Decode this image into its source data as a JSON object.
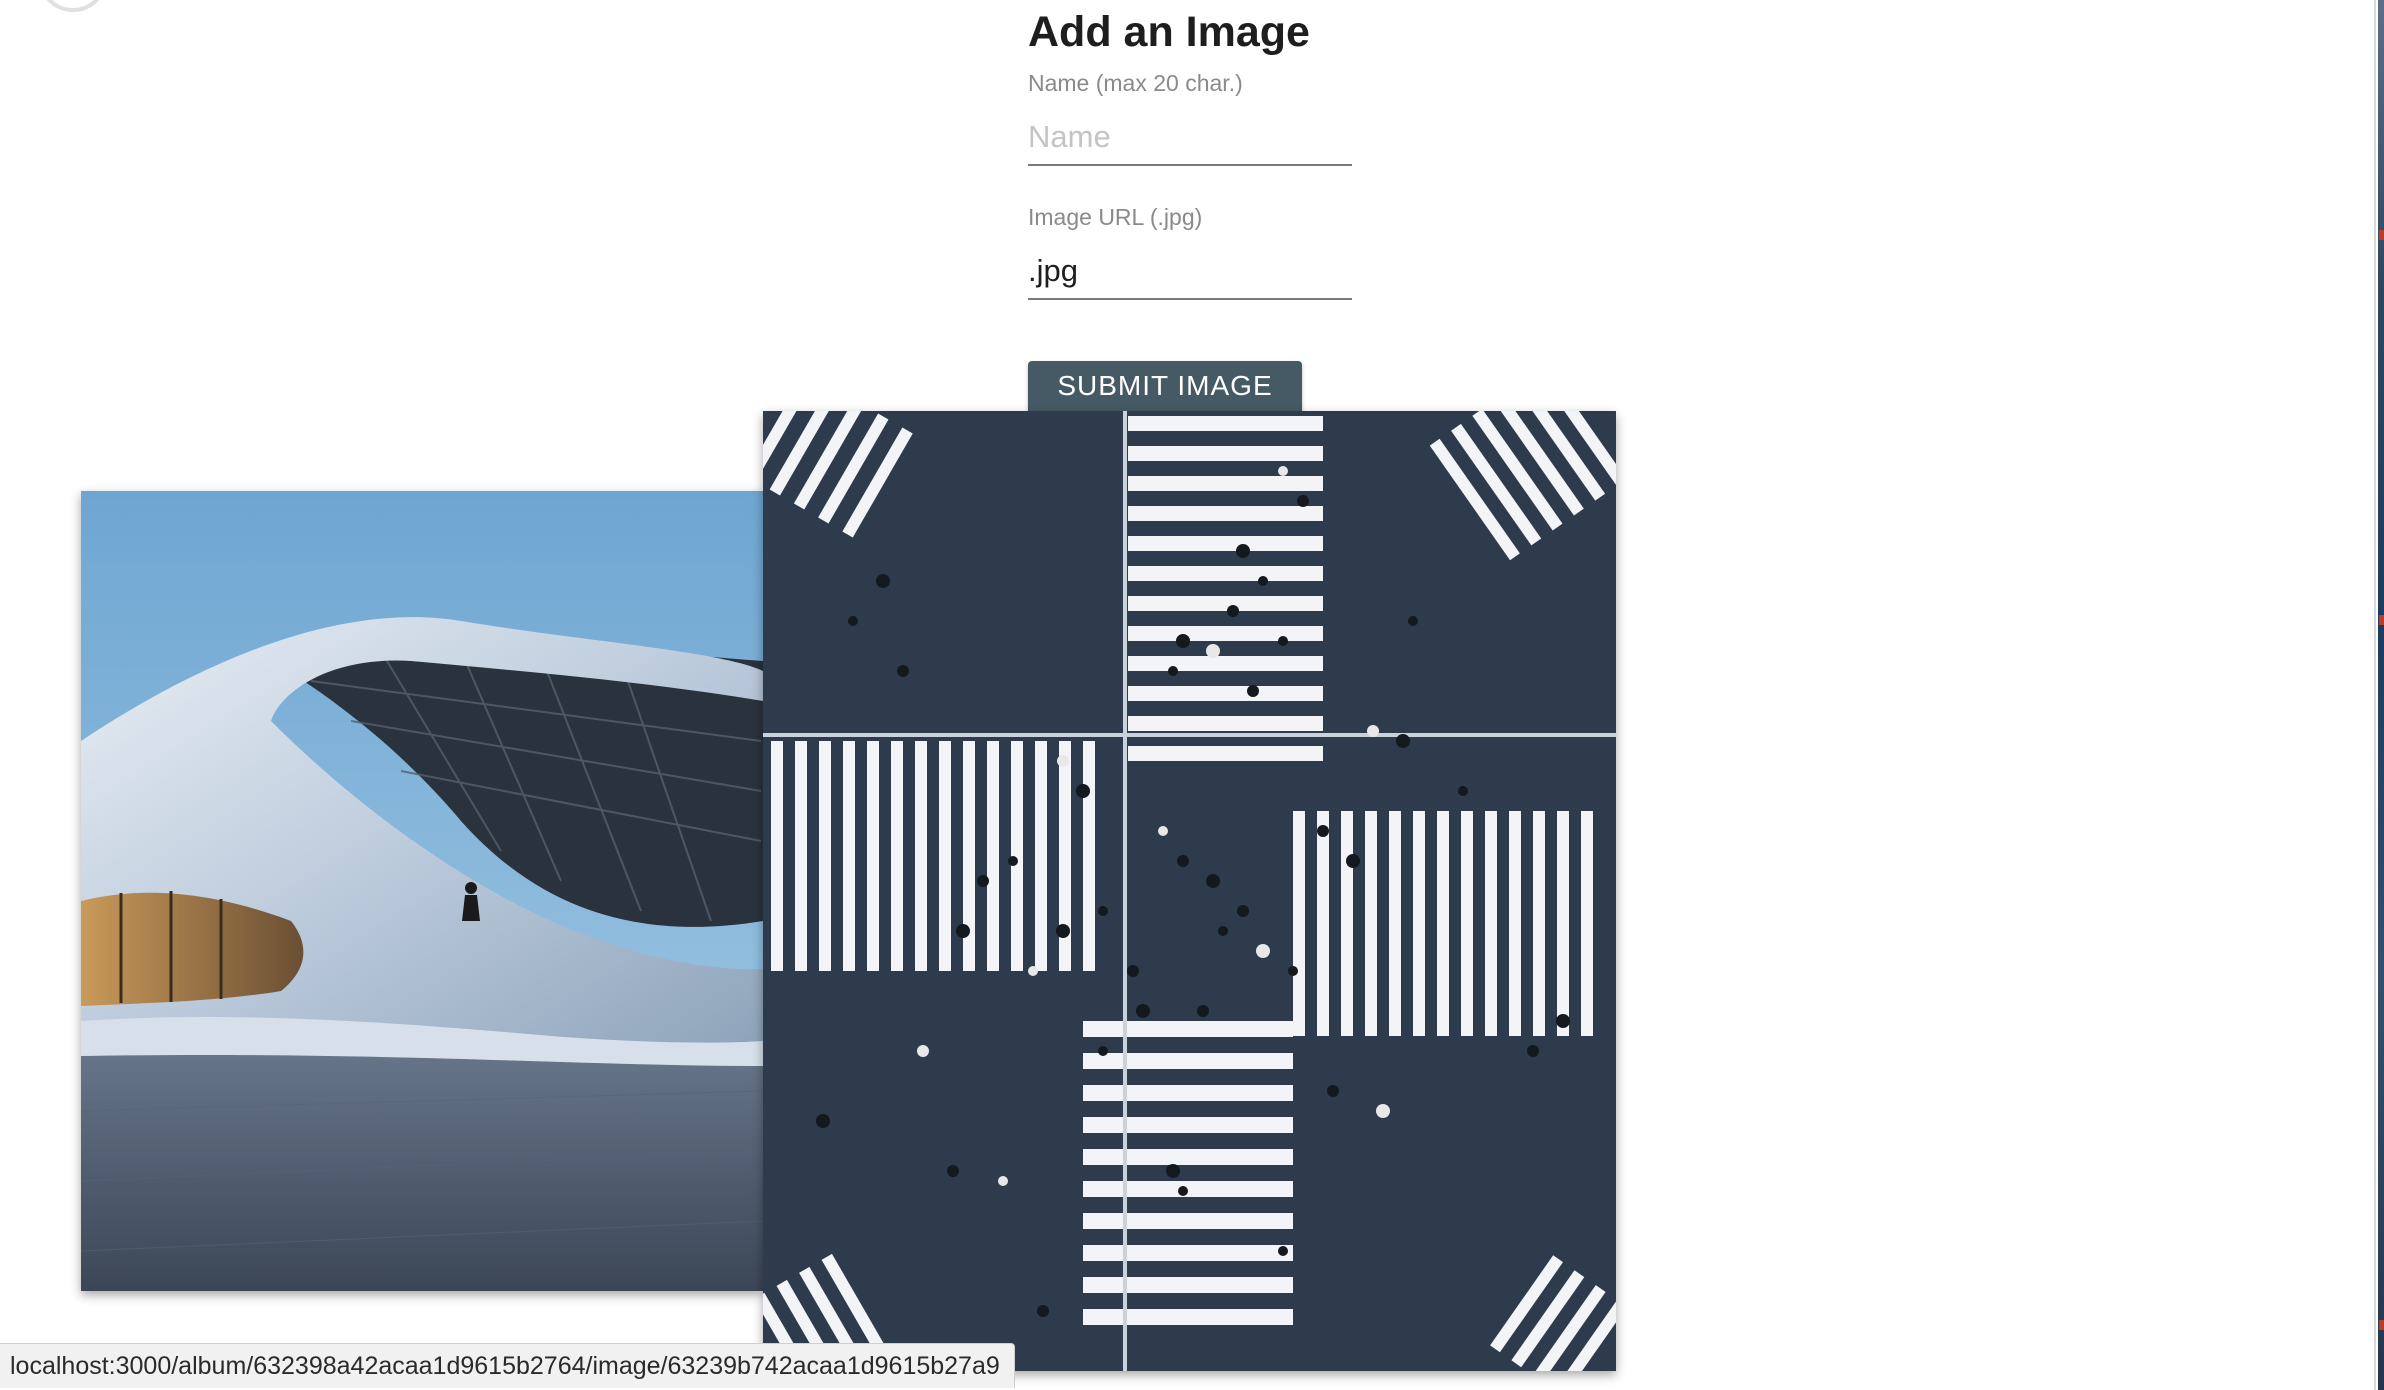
{
  "form": {
    "title": "Add an Image",
    "name_label": "Name (max 20 char.)",
    "name_placeholder": "Name",
    "name_value": "",
    "url_label": "Image URL (.jpg)",
    "url_value": ".jpg",
    "submit_label": "SUBMIT IMAGE"
  },
  "gallery": {
    "images": [
      {
        "subject": "curved white futuristic building against blue sky"
      },
      {
        "subject": "aerial view of pedestrian scramble crossing"
      }
    ]
  },
  "status_bar": {
    "url": "localhost:3000/album/632398a42acaa1d9615b2764/image/63239b742acaa1d9615b27a9"
  },
  "colors": {
    "button": "#455a64",
    "label": "#8a8a8a",
    "title": "#1e1e1e"
  }
}
